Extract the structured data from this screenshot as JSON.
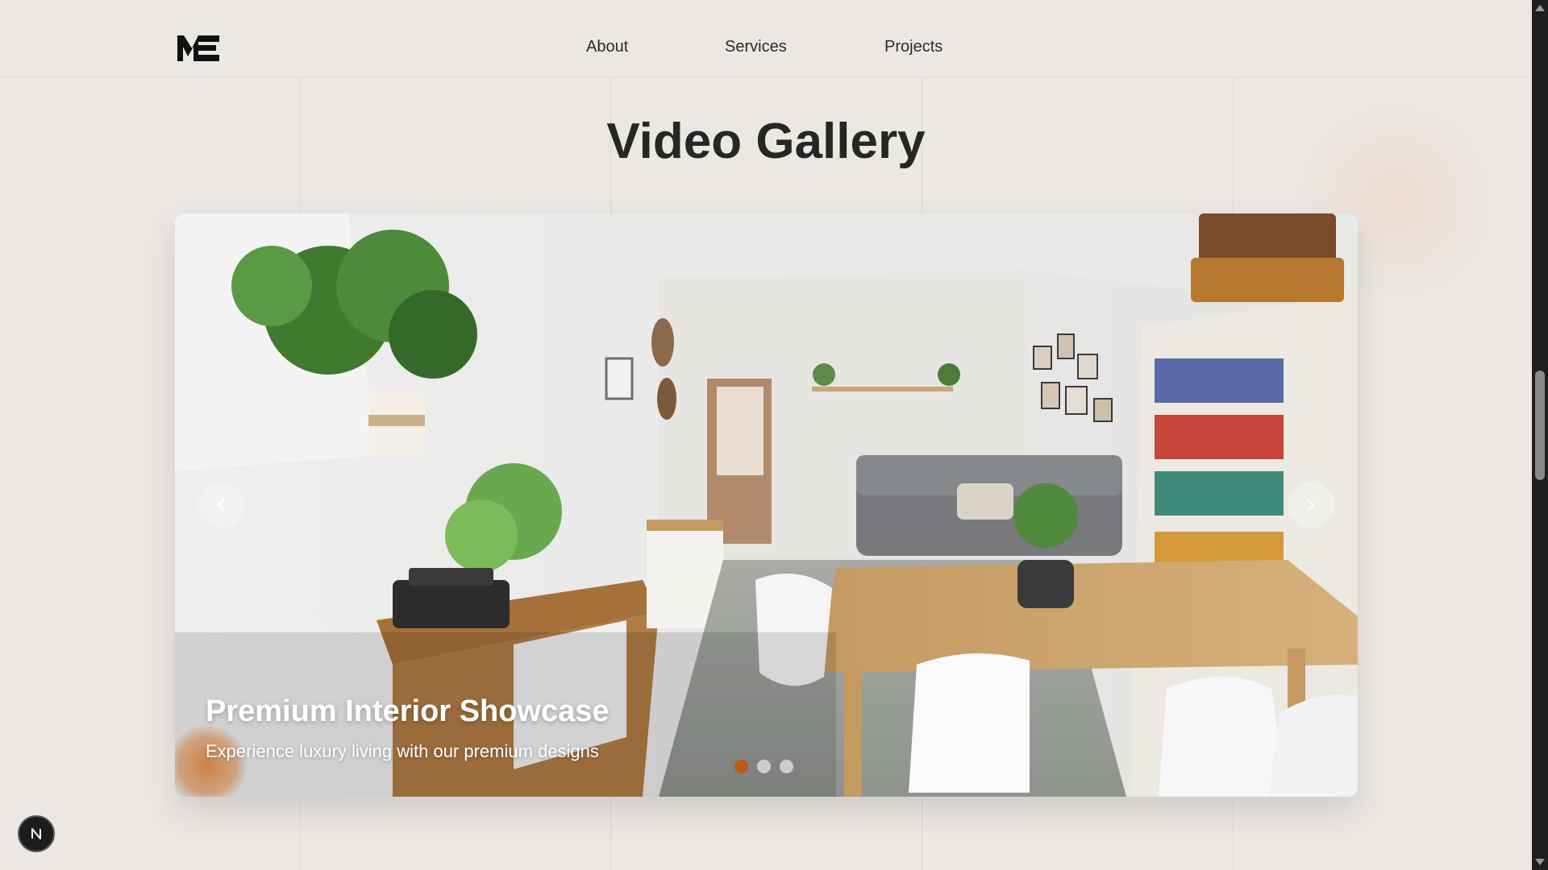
{
  "header": {
    "logo": "ME",
    "nav": [
      {
        "label": "About"
      },
      {
        "label": "Services"
      },
      {
        "label": "Projects"
      }
    ]
  },
  "main": {
    "title": "Video Gallery",
    "carousel": {
      "slide_title": "Premium Interior Showcase",
      "slide_subtitle": "Experience luxury living with our premium designs",
      "slide_count": 3,
      "active_slide": 1,
      "prev_icon": "chevron-left-icon",
      "next_icon": "chevron-right-icon"
    }
  },
  "badge": {
    "label": "N"
  },
  "colors": {
    "background": "#ebe8e4",
    "accent": "#b85a1a",
    "text": "#262626"
  }
}
